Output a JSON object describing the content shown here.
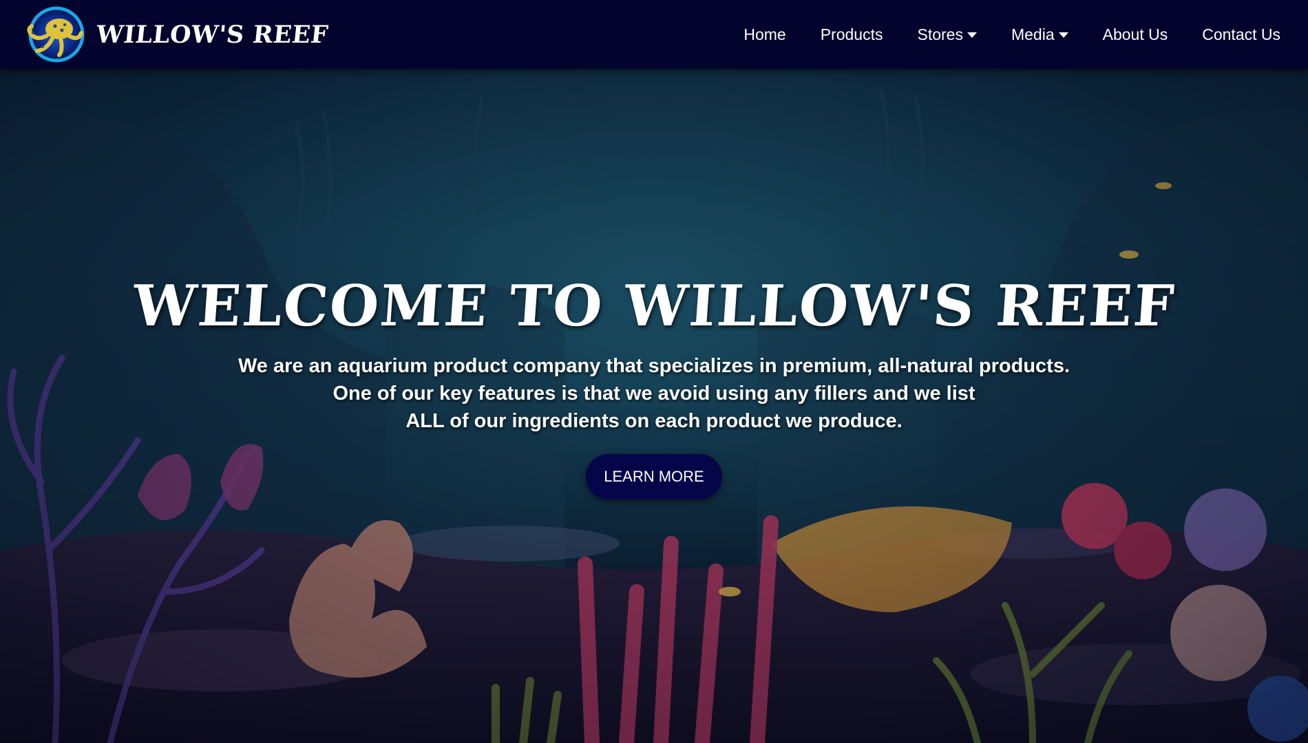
{
  "brand": {
    "name": "WILLOW'S REEF",
    "logo_icon": "octopus-logo-icon"
  },
  "nav": {
    "items": [
      {
        "label": "Home",
        "dropdown": false
      },
      {
        "label": "Products",
        "dropdown": false
      },
      {
        "label": "Stores",
        "dropdown": true
      },
      {
        "label": "Media",
        "dropdown": true
      },
      {
        "label": "About Us",
        "dropdown": false
      },
      {
        "label": "Contact Us",
        "dropdown": false
      }
    ]
  },
  "hero": {
    "title": "WELCOME TO WILLOW'S REEF",
    "lines": [
      "We are an aquarium product company that specializes in premium, all-natural products.",
      "One of our key features is that we avoid using any fillers and we list",
      "ALL of our ingredients on each product we produce."
    ],
    "cta_label": "LEARN MORE"
  },
  "colors": {
    "navbar_bg": "#03042d",
    "cta_bg": "#05064a",
    "text": "#ffffff"
  }
}
